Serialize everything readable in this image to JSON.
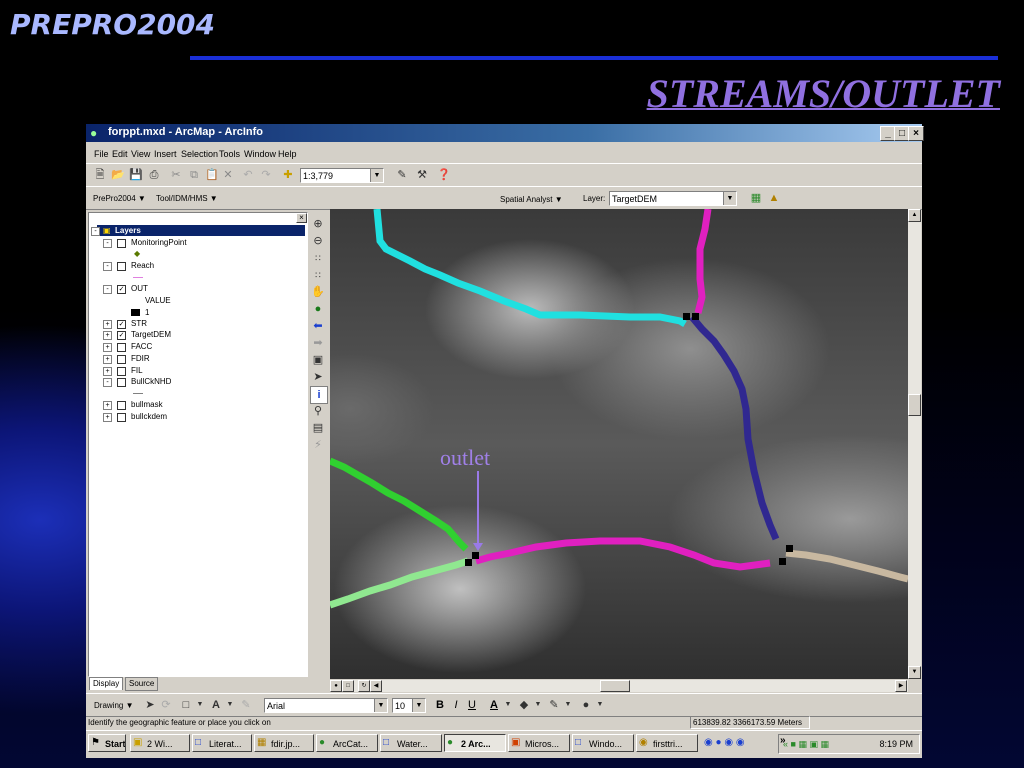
{
  "slide": {
    "title": "PREPRO2004",
    "heading": "STREAMS/OUTLET"
  },
  "window": {
    "title": "forppt.mxd - ArcMap - ArcInfo"
  },
  "menu": [
    "File",
    "Edit",
    "View",
    "Insert",
    "Selection",
    "Tools",
    "Window",
    "Help"
  ],
  "standard_toolbar": {
    "scale": "1:3,779"
  },
  "custom_toolbar": {
    "prepro": "PrePro2004 ▼",
    "tool": "Tool/IDM/HMS ▼"
  },
  "spatial_analyst": {
    "label": "Spatial Analyst ▼",
    "layer_label": "Layer:",
    "layer_value": "TargetDEM"
  },
  "toc": {
    "root": "Layers",
    "layers": [
      {
        "name": "MonitoringPoint",
        "checked": false
      },
      {
        "name": "Reach",
        "checked": false
      },
      {
        "name": "OUT",
        "checked": true
      },
      {
        "name": "VALUE",
        "checked": false
      },
      {
        "name": "1",
        "checked": false
      },
      {
        "name": "STR",
        "checked": true
      },
      {
        "name": "TargetDEM",
        "checked": true
      },
      {
        "name": "FACC",
        "checked": false
      },
      {
        "name": "FDIR",
        "checked": false
      },
      {
        "name": "FIL",
        "checked": false
      },
      {
        "name": "BullCkNHD",
        "checked": false
      },
      {
        "name": "bullmask",
        "checked": false
      },
      {
        "name": "bullckdem",
        "checked": false
      }
    ],
    "tabs": [
      "Display",
      "Source"
    ]
  },
  "map": {
    "annotation": "outlet"
  },
  "draw_toolbar": {
    "label": "Drawing ▼",
    "font": "Arial",
    "size": "10",
    "bold": "B",
    "italic": "I",
    "underline": "U"
  },
  "status": {
    "message": "Identify the geographic feature or place you click on",
    "coords": "613839.82  3366173.59 Meters"
  },
  "taskbar": {
    "start": "Start",
    "items": [
      "2 Wi...",
      "Literat...",
      "fdir.jp...",
      "ArcCat...",
      "Water...",
      "2 Arc...",
      "Micros...",
      "Windo...",
      "firsttri..."
    ],
    "clock": "8:19 PM"
  },
  "colors": {
    "cyan": "#20e0e0",
    "magenta": "#e020c0",
    "navy": "#302890",
    "green": "#30d030",
    "lightgreen": "#90e890",
    "tan": "#c8b8a0"
  }
}
